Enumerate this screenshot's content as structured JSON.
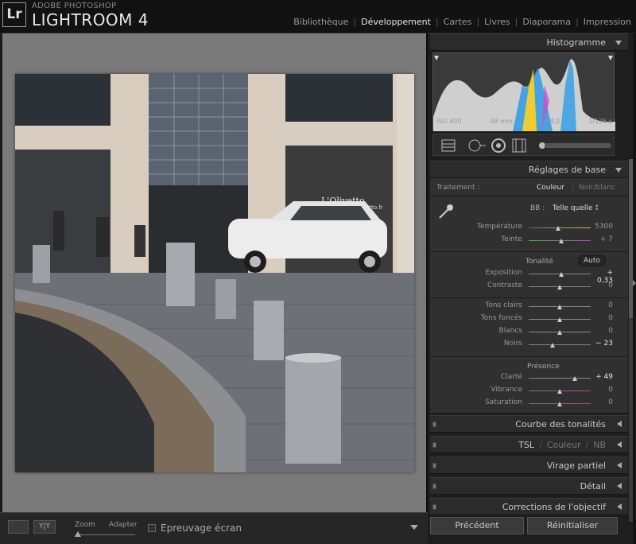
{
  "app": {
    "brand_small": "ADOBE PHOTOSHOP",
    "brand_big": "LIGHTROOM 4",
    "logo": "Lr"
  },
  "modules": [
    "Bibliothèque",
    "Développement",
    "Cartes",
    "Livres",
    "Diaporama",
    "Impression"
  ],
  "active_module": "Développement",
  "photo": {
    "shop_sign": "L'Olivetto",
    "url_sign": "www.lolivetto.fr"
  },
  "toolbar": {
    "zoom_label": "Zoom",
    "zoom_value": "Adapter",
    "softproof_label": "Epreuvage écran"
  },
  "histogram": {
    "title": "Histogramme",
    "iso": "ISO 400",
    "focal": "48 mm",
    "aperture": "ƒ / 8,0",
    "shutter": "1/125 s"
  },
  "basic": {
    "title": "Réglages de base",
    "treatment_label": "Traitement :",
    "treatment_color": "Couleur",
    "treatment_bw": "Noir/blanc",
    "wb_label": "BB :",
    "wb_value": "Telle quelle",
    "tone_label": "Tonalité",
    "auto_label": "Auto",
    "presence_label": "Présence",
    "sliders": {
      "temperature": {
        "label": "Température",
        "value": "5300",
        "pos": 0.47
      },
      "tint": {
        "label": "Teinte",
        "value": "+ 7",
        "pos": 0.52
      },
      "exposure": {
        "label": "Exposition",
        "value": "+ 0,33",
        "pos": 0.52
      },
      "contrast": {
        "label": "Contraste",
        "value": "0",
        "pos": 0.5
      },
      "highlights": {
        "label": "Tons clairs",
        "value": "0",
        "pos": 0.5
      },
      "shadows": {
        "label": "Tons foncés",
        "value": "0",
        "pos": 0.5
      },
      "whites": {
        "label": "Blancs",
        "value": "0",
        "pos": 0.5
      },
      "blacks": {
        "label": "Noirs",
        "value": "− 23",
        "pos": 0.385
      },
      "clarity": {
        "label": "Clarté",
        "value": "+ 49",
        "pos": 0.745
      },
      "vibrance": {
        "label": "Vibrance",
        "value": "0",
        "pos": 0.5
      },
      "saturation": {
        "label": "Saturation",
        "value": "0",
        "pos": 0.5
      }
    }
  },
  "panels": {
    "tone_curve": "Courbe des tonalités",
    "hsl_a": "TSL",
    "hsl_b": "Couleur",
    "hsl_c": "NB",
    "split_toning": "Virage partiel",
    "detail": "Détail",
    "lens": "Corrections de l'objectif"
  },
  "buttons": {
    "previous": "Précédent",
    "reset": "Réinitialiser"
  },
  "colors": {
    "panel_bg": "#303030",
    "header_bg": "#2b2b2b",
    "preview_bg": "#7a7a7a"
  }
}
